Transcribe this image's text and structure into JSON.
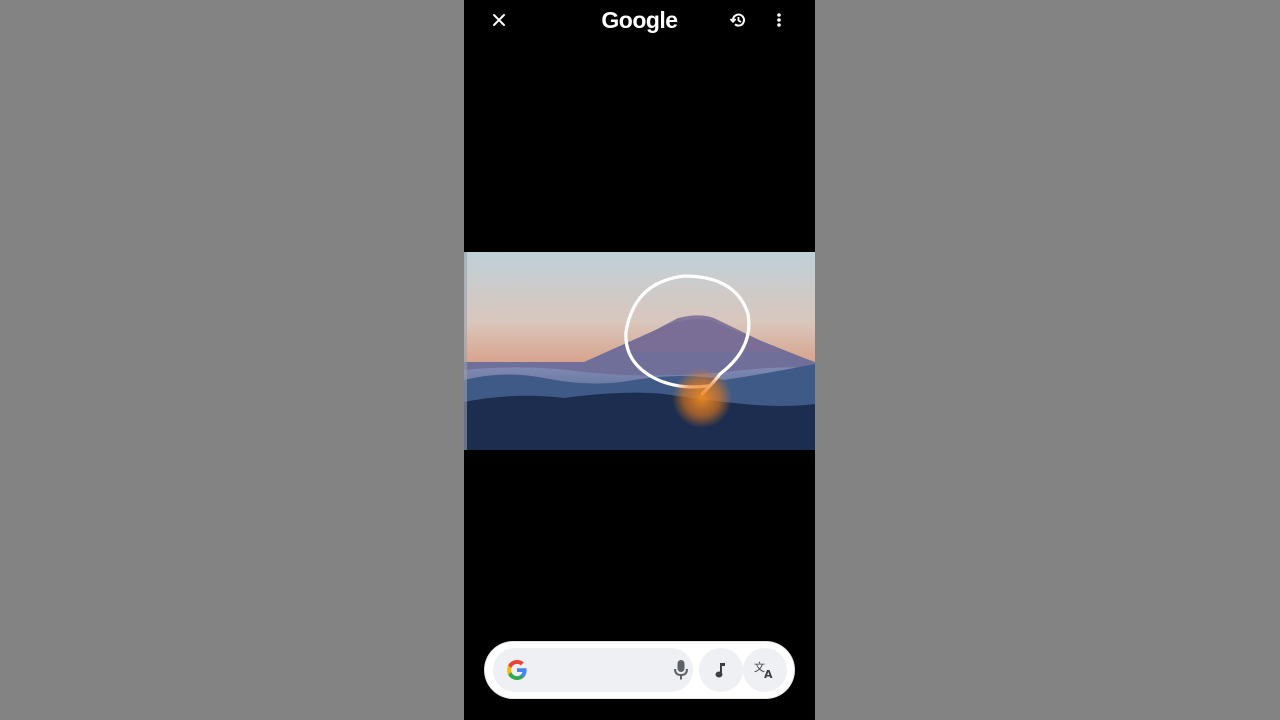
{
  "header": {
    "logo_text": "Google",
    "close_icon": "close-icon",
    "history_icon": "history-icon",
    "more_icon": "more-vert-icon"
  },
  "photo": {
    "description_icon": "mountain-photo",
    "annotation": "circle-gesture"
  },
  "search_bar": {
    "placeholder": "",
    "icons": [
      "google-g-icon",
      "mic-icon",
      "music-note-icon",
      "translate-icon"
    ]
  },
  "colors": {
    "background": "#838383",
    "phone": "#000000",
    "pill": "#ffffff",
    "field": "#eef0f4",
    "icon_dark": "#3c4043"
  }
}
